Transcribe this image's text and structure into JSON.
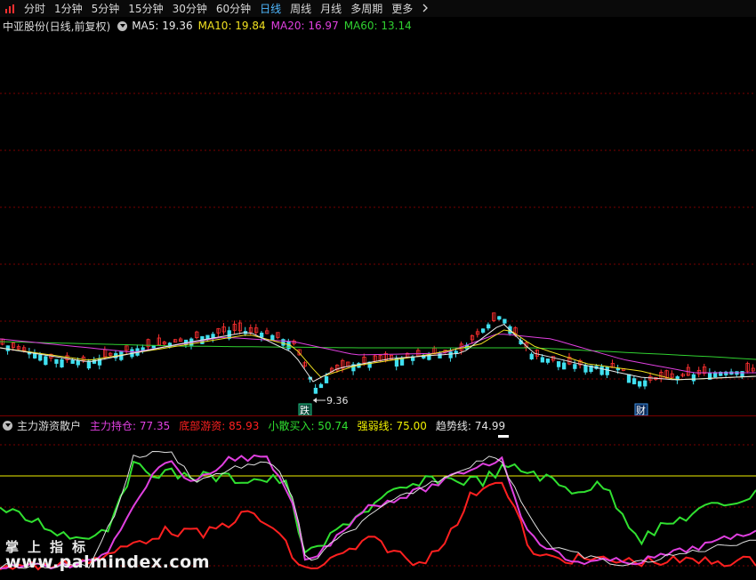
{
  "toolbar": {
    "periods": [
      "分时",
      "1分钟",
      "5分钟",
      "15分钟",
      "30分钟",
      "60分钟",
      "日线",
      "周线",
      "月线",
      "多周期",
      "更多"
    ],
    "active": "日线",
    "active_color": "#4fb8ff"
  },
  "main": {
    "title": "中亚股份(日线,前复权)",
    "ma": [
      {
        "label": "MA5: 19.36",
        "color": "#e8e8e8"
      },
      {
        "label": "MA10: 19.84",
        "color": "#f0e020"
      },
      {
        "label": "MA20: 16.97",
        "color": "#e040e0"
      },
      {
        "label": "MA60: 13.14",
        "color": "#30d030"
      }
    ],
    "low_label": "9.36",
    "badge_left": "跌",
    "badge_right": "财"
  },
  "indicator": {
    "title": "主力游资散户",
    "series": [
      {
        "label": "主力持仓: 77.35",
        "color": "#e040e0"
      },
      {
        "label": "底部游资: 85.93",
        "color": "#ff2020"
      },
      {
        "label": "小散买入: 50.74",
        "color": "#30e030"
      },
      {
        "label": "强弱线: 75.00",
        "color": "#f0f000"
      },
      {
        "label": "趋势线: 74.99",
        "color": "#e0e0e0"
      }
    ]
  },
  "watermark": {
    "line1": "掌上指标",
    "line2": "www.palmindex.com"
  },
  "colors": {
    "up": "#ff3030",
    "down": "#40e0f0",
    "grid": "#7a0000"
  }
}
